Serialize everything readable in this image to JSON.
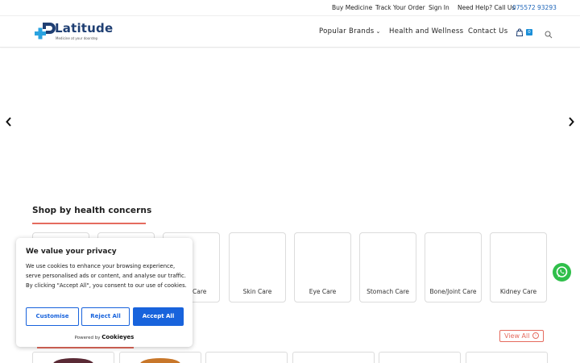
{
  "topbar": {
    "buy_medicine": "Buy Medicine",
    "track_order": "Track Your Order",
    "sign_in": "Sign In",
    "need_help": "Need Help? Call Us",
    "phone": "075572 93293"
  },
  "header": {
    "logo_text": "Latitude",
    "logo_tagline": "Medicine at your doorstep",
    "nav": {
      "popular_brands": "Popular Brands",
      "health_wellness": "Health and Wellness",
      "contact_us": "Contact Us"
    },
    "cart_count": "0"
  },
  "carousel": {
    "prev_icon": "chevron-left-icon",
    "next_icon": "chevron-right-icon"
  },
  "health_concerns": {
    "title": "Shop by health concerns",
    "cards": [
      {
        "label": ""
      },
      {
        "label": ""
      },
      {
        "label": "Care"
      },
      {
        "label": "Skin Care"
      },
      {
        "label": "Eye Care"
      },
      {
        "label": "Stomach Care"
      },
      {
        "label": "Bone/Joint Care"
      },
      {
        "label": "Kidney Care"
      }
    ]
  },
  "products": {
    "view_all": "View All"
  },
  "cookie_banner": {
    "title": "We value your privacy",
    "text": "We use cookies to enhance your browsing experience, serve personalised ads or content, and analyse our traffic. By clicking \"Accept All\", you consent to our use of cookies.",
    "customise": "Customise",
    "reject_all": "Reject All",
    "accept_all": "Accept All",
    "powered_by": "Powered by",
    "brand": "Cookieyes"
  },
  "colors": {
    "brand_blue": "#1f3f73",
    "accent_red": "#e56b5e",
    "cookie_blue": "#1863dc",
    "whatsapp_green": "#2fbf4a"
  }
}
